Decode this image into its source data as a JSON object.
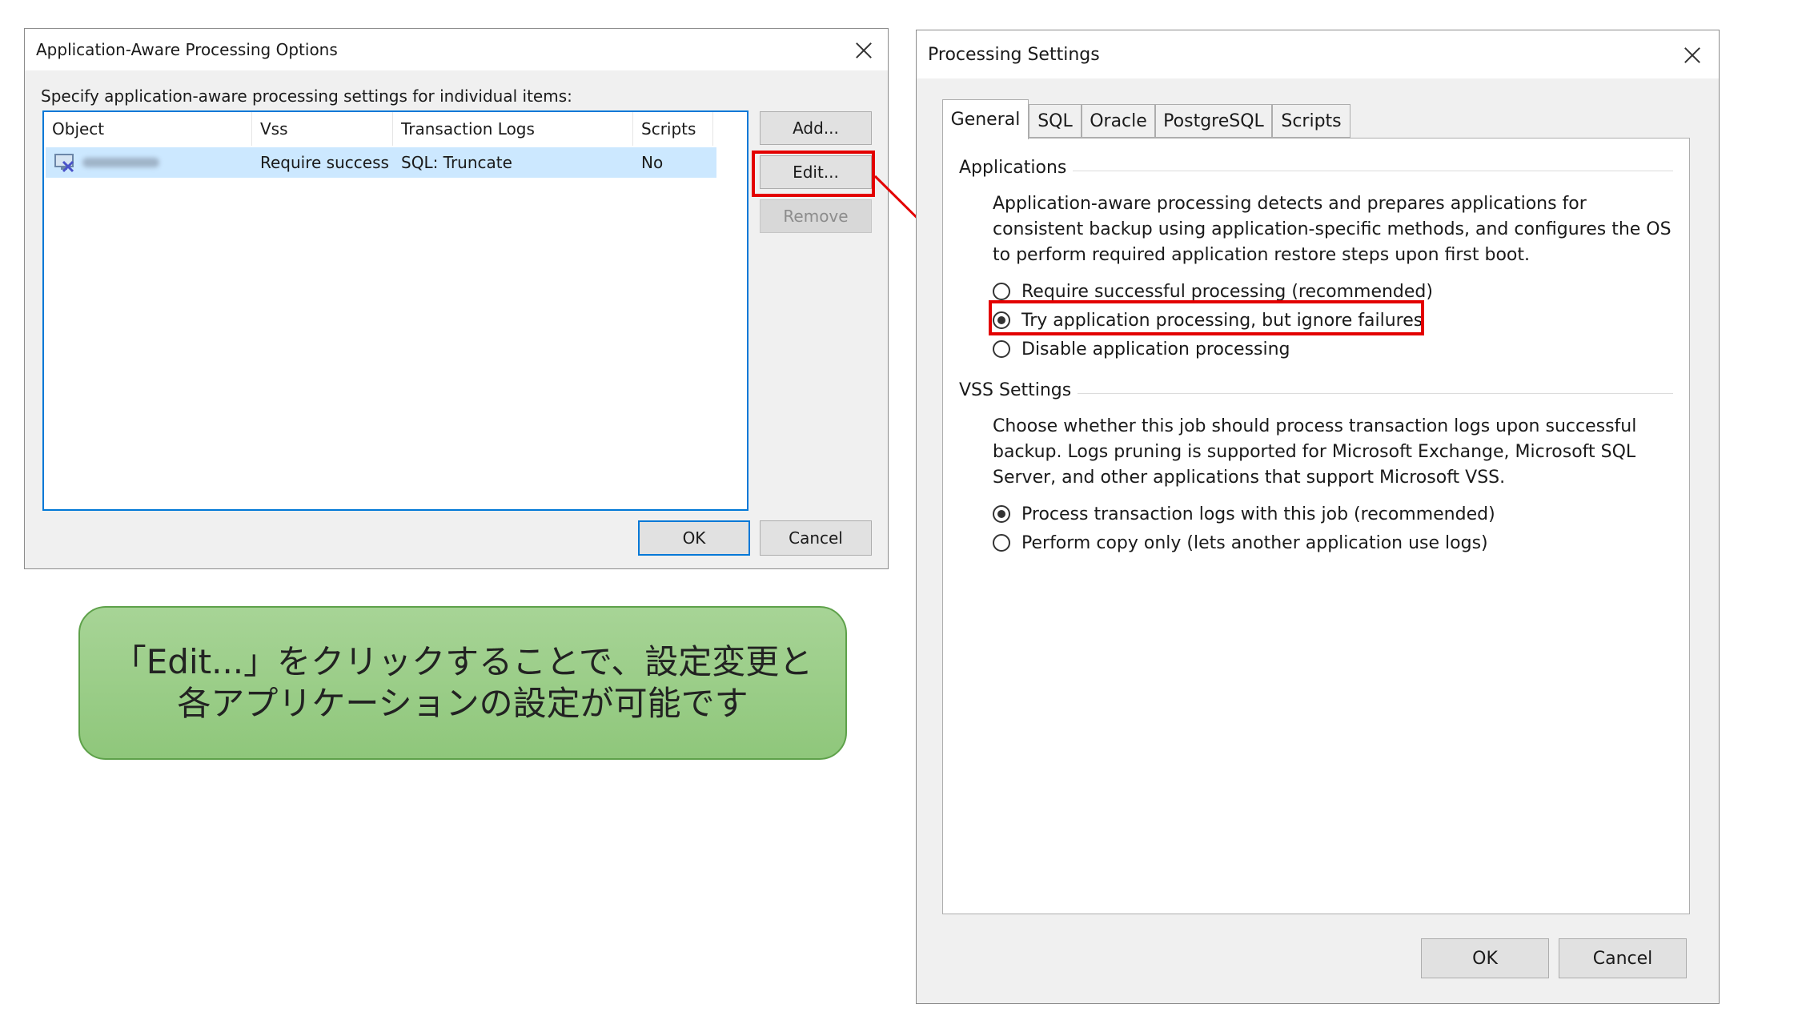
{
  "left_dialog": {
    "title": "Application-Aware Processing Options",
    "instruction": "Specify application-aware processing settings for individual items:",
    "columns": [
      "Object",
      "Vss",
      "Transaction Logs",
      "Scripts"
    ],
    "row": {
      "icon": "vm-icon",
      "vss": "Require success",
      "transaction_logs": "SQL: Truncate",
      "scripts": "No"
    },
    "buttons": {
      "add": "Add...",
      "edit": "Edit...",
      "remove": "Remove",
      "ok": "OK",
      "cancel": "Cancel"
    }
  },
  "right_dialog": {
    "title": "Processing Settings",
    "tabs": [
      "General",
      "SQL",
      "Oracle",
      "PostgreSQL",
      "Scripts"
    ],
    "applications": {
      "title": "Applications",
      "description": "Application-aware processing detects and prepares applications for consistent backup using application-specific methods, and configures the OS to perform required application restore steps upon first boot.",
      "options": [
        {
          "label": "Require successful processing (recommended)",
          "checked": false
        },
        {
          "label": "Try application processing, but ignore failures",
          "checked": true
        },
        {
          "label": "Disable application processing",
          "checked": false
        }
      ]
    },
    "vss": {
      "title": "VSS Settings",
      "description": "Choose whether this job should process transaction logs upon successful backup. Logs pruning is supported for Microsoft Exchange, Microsoft SQL Server, and other applications that support Microsoft VSS.",
      "options": [
        {
          "label": "Process transaction logs with this job (recommended)",
          "checked": true
        },
        {
          "label": "Perform copy only (lets another application use logs)",
          "checked": false
        }
      ]
    },
    "buttons": {
      "ok": "OK",
      "cancel": "Cancel"
    }
  },
  "callout": {
    "line1": "「Edit...」をクリックすることで、設定変更と",
    "line2": "各アプリケーションの設定が可能です"
  },
  "colors": {
    "highlight": "#e30000",
    "accent": "#0078d7",
    "selection": "#cce8ff",
    "callout_fill": "#9ccd88"
  }
}
